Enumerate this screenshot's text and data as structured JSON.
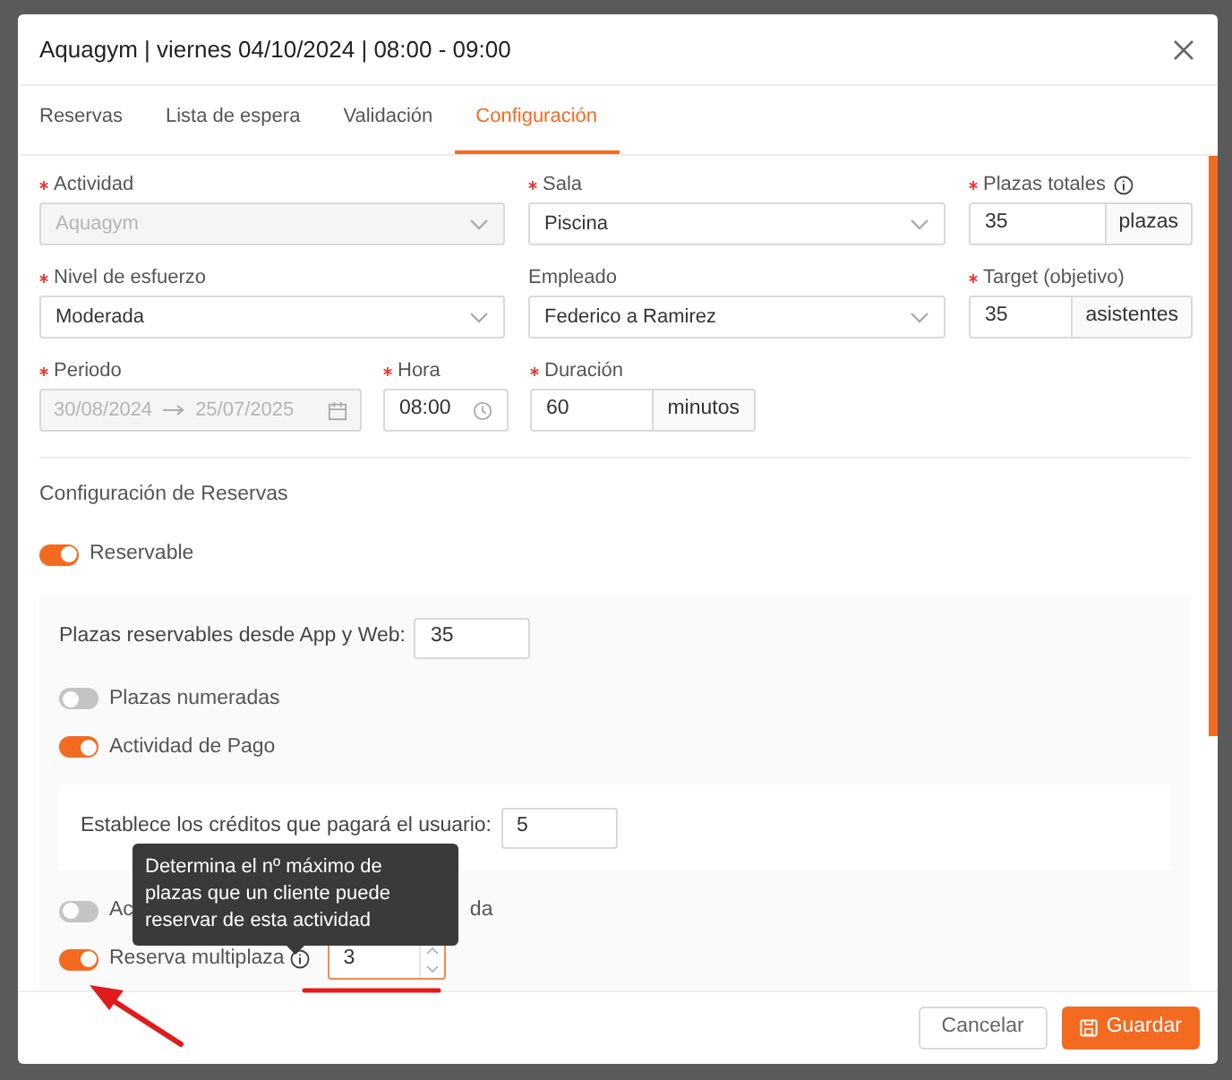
{
  "dialog": {
    "title": "Aquagym | viernes 04/10/2024 | 08:00 - 09:00"
  },
  "tabs": [
    {
      "label": "Reservas",
      "selected": false
    },
    {
      "label": "Lista de espera",
      "selected": false
    },
    {
      "label": "Validación",
      "selected": false
    },
    {
      "label": "Configuración",
      "selected": true
    }
  ],
  "fields": [
    {
      "label": "Actividad",
      "required": true,
      "kind": "select",
      "value": "Aquagym",
      "disabled": true
    },
    {
      "label": "Sala",
      "required": true,
      "kind": "select",
      "value": "Piscina",
      "disabled": false
    },
    {
      "label": "Plazas totales",
      "required": true,
      "kind": "addon",
      "value": "35",
      "addon": "plazas",
      "info": true
    },
    {
      "label": "Nivel de esfuerzo",
      "required": true,
      "kind": "select",
      "value": "Moderada",
      "disabled": false
    },
    {
      "label": "Empleado",
      "required": false,
      "kind": "select",
      "value": "Federico a Ramirez",
      "disabled": false
    },
    {
      "label": "Target (objetivo)",
      "required": true,
      "kind": "addon",
      "value": "35",
      "addon": "asistentes",
      "info": false
    }
  ],
  "row3": {
    "periodo": {
      "label": "Periodo",
      "required": true,
      "start": "30/08/2024",
      "end": "25/07/2025"
    },
    "hora": {
      "label": "Hora",
      "required": true,
      "value": "08:00"
    },
    "duracion": {
      "label": "Duración",
      "required": true,
      "value": "60",
      "addon": "minutos"
    }
  },
  "section_title": "Configuración de Reservas",
  "reservable": {
    "label": "Reservable",
    "on": true
  },
  "plazas_reservables": {
    "label": "Plazas reservables desde App y Web:",
    "value": "35"
  },
  "switches": [
    {
      "label": "Plazas numeradas",
      "on": false
    },
    {
      "label": "Actividad de Pago",
      "on": true
    }
  ],
  "creditos": {
    "label": "Establece los créditos que pagará el usuario:",
    "value": "5"
  },
  "covered_switch": {
    "on": false,
    "label_start": "Ac",
    "label_end": "da"
  },
  "multiplaza": {
    "label": "Reserva multiplaza",
    "on": true,
    "value": "3"
  },
  "tooltip": "Determina el nº máximo de plazas que un cliente puede reservar de esta actividad",
  "buttons": [
    {
      "label": "Cancelar",
      "kind": "secondary"
    },
    {
      "label": "Guardar",
      "kind": "primary"
    }
  ]
}
